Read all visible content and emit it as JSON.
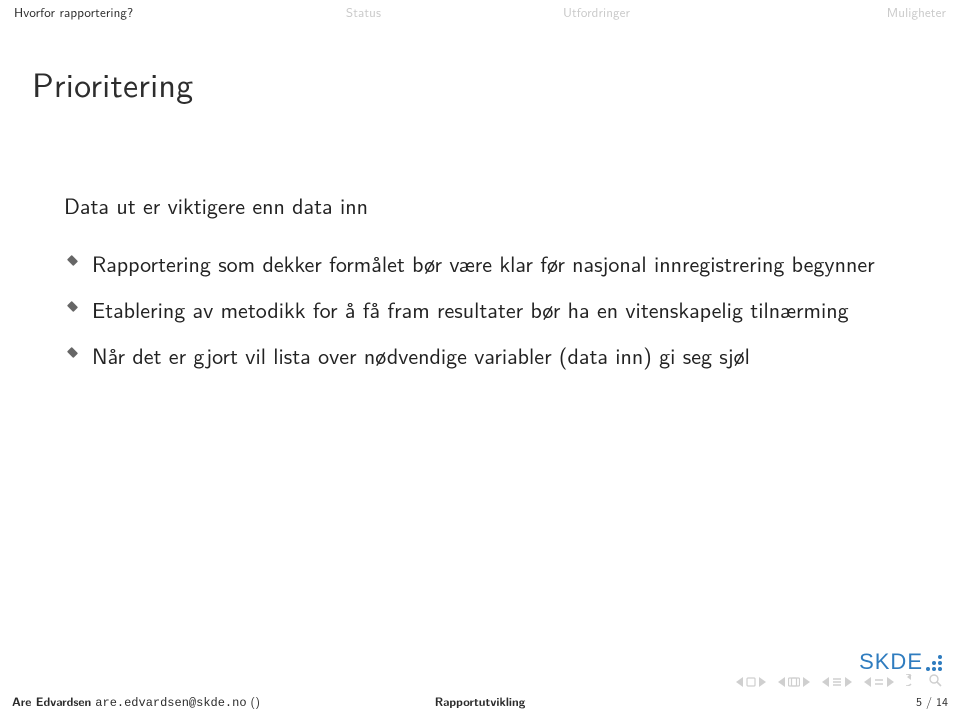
{
  "nav": {
    "items": [
      {
        "label": "Hvorfor rapportering?",
        "active": true
      },
      {
        "label": "Status",
        "active": false
      },
      {
        "label": "Utfordringer",
        "active": false
      },
      {
        "label": "Muligheter",
        "active": false
      }
    ]
  },
  "title": "Prioritering",
  "intro": "Data ut er viktigere enn data inn",
  "bullets": [
    "Rapportering som dekker formålet bør være klar før nasjonal innregistrering begynner",
    "Etablering av metodikk for å få fram resultater bør ha en vitenskapelig tilnærming",
    "Når det er gjort vil lista over nødvendige variabler (data inn) gi seg sjøl"
  ],
  "logo": {
    "text": "SKDE"
  },
  "footer": {
    "author": "Are Edvardsen",
    "email": "are.edvardsen@skde.no",
    "affil": "()",
    "center": "Rapportutvikling",
    "page_current": "5",
    "page_sep": " / ",
    "page_total": "14"
  }
}
